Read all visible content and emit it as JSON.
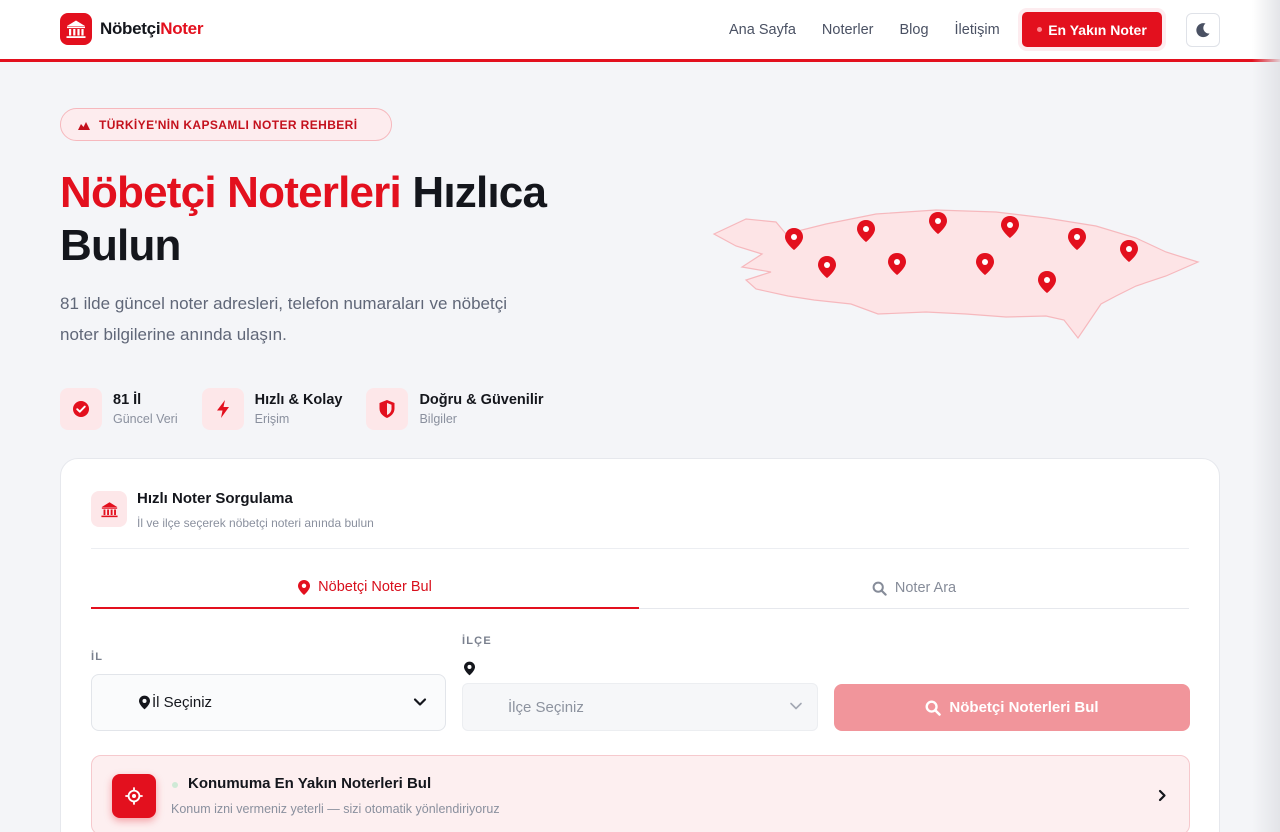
{
  "header": {
    "logo": {
      "part1": "Nöbetçi",
      "part2": "Noter"
    },
    "nav": [
      "Ana Sayfa",
      "Noterler",
      "Blog",
      "İletişim"
    ],
    "cta": "En Yakın Noter",
    "theme_toggle_icon": "moon-icon"
  },
  "hero": {
    "badge": "TÜRKİYE'NİN KAPSAMLI NOTER REHBERİ",
    "title_red": "Nöbetçi Noterleri",
    "title_rest": " Hızlıca Bulun",
    "subtitle": "81 ilde güncel noter adresleri, telefon numaraları ve nöbetçi noter bilgilerine anında ulaşın.",
    "features": [
      {
        "title": "81 İl",
        "subtitle": "Güncel Veri",
        "icon": "check-circle-icon"
      },
      {
        "title": "Hızlı & Kolay",
        "subtitle": "Erişim",
        "icon": "lightning-icon"
      },
      {
        "title": "Doğru & Güvenilir",
        "subtitle": "Bilgiler",
        "icon": "shield-icon"
      }
    ]
  },
  "search_card": {
    "title": "Hızlı Noter Sorgulama",
    "subtitle": "İl ve ilçe seçerek nöbetçi noteri anında bulun",
    "tabs": [
      {
        "label": "Nöbetçi Noter Bul",
        "active": true
      },
      {
        "label": "Noter Ara",
        "active": false
      }
    ],
    "il_label": "İL",
    "il_value": "İl Seçiniz",
    "ilce_label": "İLÇE",
    "ilce_value": "İlçe Seçiniz",
    "search_button": "Nöbetçi Noterleri Bul",
    "nearest": {
      "title": "Konumuma En Yakın Noterleri Bul",
      "subtitle": "Konum izni vermeniz yeterli — sizi otomatik yönlendiriyoruz"
    }
  },
  "colors": {
    "accent": "#e3101e",
    "accent_soft": "#fde7e9",
    "text": "#14161c",
    "muted": "#8a909e"
  }
}
